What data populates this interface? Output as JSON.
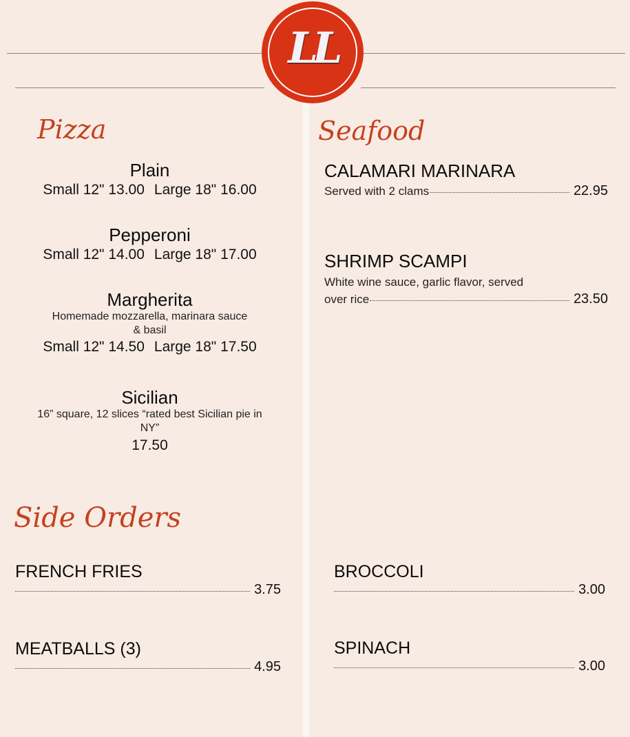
{
  "logo": {
    "text": "LL"
  },
  "pizza": {
    "title": "Pizza",
    "items": [
      {
        "name": "Plain",
        "small": "Small 12\" 13.00",
        "large": "Large 18\" 16.00"
      },
      {
        "name": "Pepperoni",
        "small": "Small 12\" 14.00",
        "large": "Large 18\" 17.00"
      },
      {
        "name": "Margherita",
        "description": "Homemade mozzarella, marinara sauce & basil",
        "small": "Small 12\" 14.50",
        "large": "Large 18\" 17.50"
      },
      {
        "name": "Sicilian",
        "description": "16” square, 12 slices “rated best Sicilian pie in NY”",
        "price": "17.50"
      }
    ]
  },
  "seafood": {
    "title": "Seafood",
    "items": [
      {
        "name": "CALAMARI MARINARA",
        "description": "Served with 2 clams",
        "price": "22.95"
      },
      {
        "name": "SHRIMP SCAMPI",
        "description_line1": "White wine sauce, garlic flavor, served",
        "description_line2": "over rice",
        "price": "23.50"
      }
    ]
  },
  "side_orders": {
    "title": "Side Orders",
    "items": [
      {
        "name": "FRENCH FRIES",
        "price": "3.75"
      },
      {
        "name": "BROCCOLI",
        "price": "3.00"
      },
      {
        "name": "MEATBALLS (3)",
        "price": "4.95"
      },
      {
        "name": "SPINACH",
        "price": "3.00"
      }
    ]
  },
  "colors": {
    "background": "#f8ebe4",
    "accent": "#c4421f",
    "logo_red": "#d83315",
    "divider": "#fbf6f3"
  }
}
